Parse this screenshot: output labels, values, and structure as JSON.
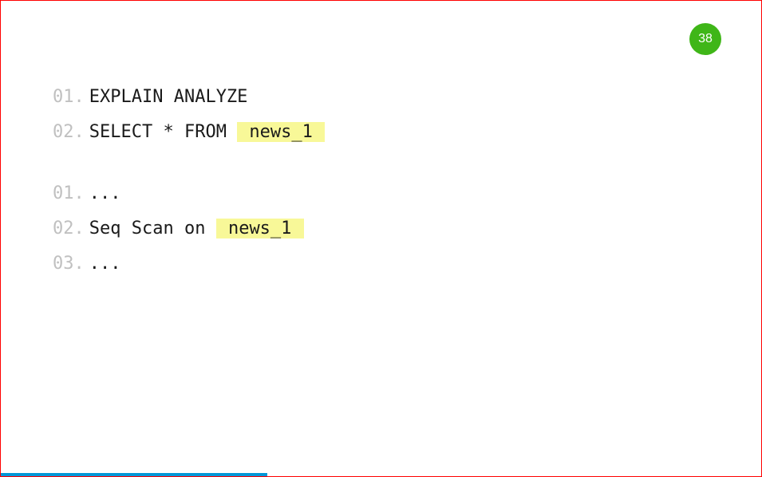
{
  "page_number": "38",
  "progress_percent": 35,
  "block1": {
    "lines": [
      {
        "num": "01.",
        "segments": [
          {
            "text": "EXPLAIN ANALYZE",
            "hl": false
          }
        ]
      },
      {
        "num": "02.",
        "segments": [
          {
            "text": "SELECT * FROM ",
            "hl": false
          },
          {
            "text": " news_1 ",
            "hl": true
          }
        ]
      }
    ]
  },
  "block2": {
    "lines": [
      {
        "num": "01.",
        "segments": [
          {
            "text": "...",
            "hl": false
          }
        ]
      },
      {
        "num": "02.",
        "segments": [
          {
            "text": "Seq Scan on ",
            "hl": false
          },
          {
            "text": " news_1 ",
            "hl": true
          }
        ]
      },
      {
        "num": "03.",
        "segments": [
          {
            "text": "...",
            "hl": false
          }
        ]
      }
    ]
  }
}
